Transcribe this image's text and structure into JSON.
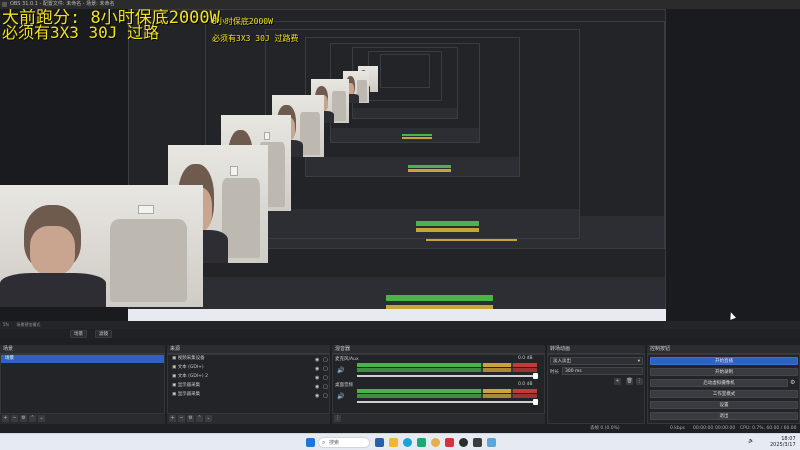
{
  "window": {
    "title": "OBS 31.0.1 - 配置文件: 未命名 - 场景: 未命名"
  },
  "overlay": {
    "line1": "大前跑分: 8小时保底2000W",
    "line2": "必须有3X3 30J 过路",
    "nested_line1": "8小时保底2000W",
    "nested_line2": "必须有3X3 30J 过路费"
  },
  "top_strip": {
    "label1": "5fs",
    "label2": "场景预览模式"
  },
  "tabs": {
    "scene_tab": "场景",
    "filter_tab": "滤镜"
  },
  "scenes_dock": {
    "title": "场景",
    "items": [
      "场景"
    ]
  },
  "sources_dock": {
    "title": "来源",
    "items": [
      "视频采集设备",
      "文本 (GDI+)",
      "文本 (GDI+) 2",
      "显示器采集",
      "显示器采集"
    ]
  },
  "mixer_dock": {
    "title": "混音器",
    "tracks": [
      {
        "name": "麦克风/Aux",
        "level": "0.0 dB"
      },
      {
        "name": "桌面音频",
        "level": "0.0 dB"
      }
    ],
    "scale": [
      "-60",
      "-55",
      "-50",
      "-45",
      "-40",
      "-35",
      "-30",
      "-25",
      "-20",
      "-15",
      "-10",
      "-5",
      "0"
    ]
  },
  "transitions_dock": {
    "title": "转场动画",
    "transition": "淡入淡出",
    "duration_label": "时长",
    "duration_value": "300 ms"
  },
  "controls_dock": {
    "title": "控制按钮",
    "buttons": [
      "开始直播",
      "开始录制",
      "启动虚拟摄像机",
      "工作室模式",
      "设置",
      "退出"
    ]
  },
  "statusbar": {
    "dropped": "丢帧 0 (0.0%)",
    "live": "00:00:00",
    "rec": "00:00:00",
    "cpu": "CPU: 0.7%, 60.00 / 60.00 FPS",
    "bitrate": "0 kbps"
  },
  "taskbar": {
    "search_placeholder": "搜索",
    "time": "18:07",
    "date": "2025/3/17"
  },
  "colors": {
    "accent": "#2f60c3",
    "meter_green": "#4bb34b",
    "meter_yellow": "#c9a43a",
    "meter_red": "#c23a3a",
    "overlay_text": "#f2e21c"
  }
}
